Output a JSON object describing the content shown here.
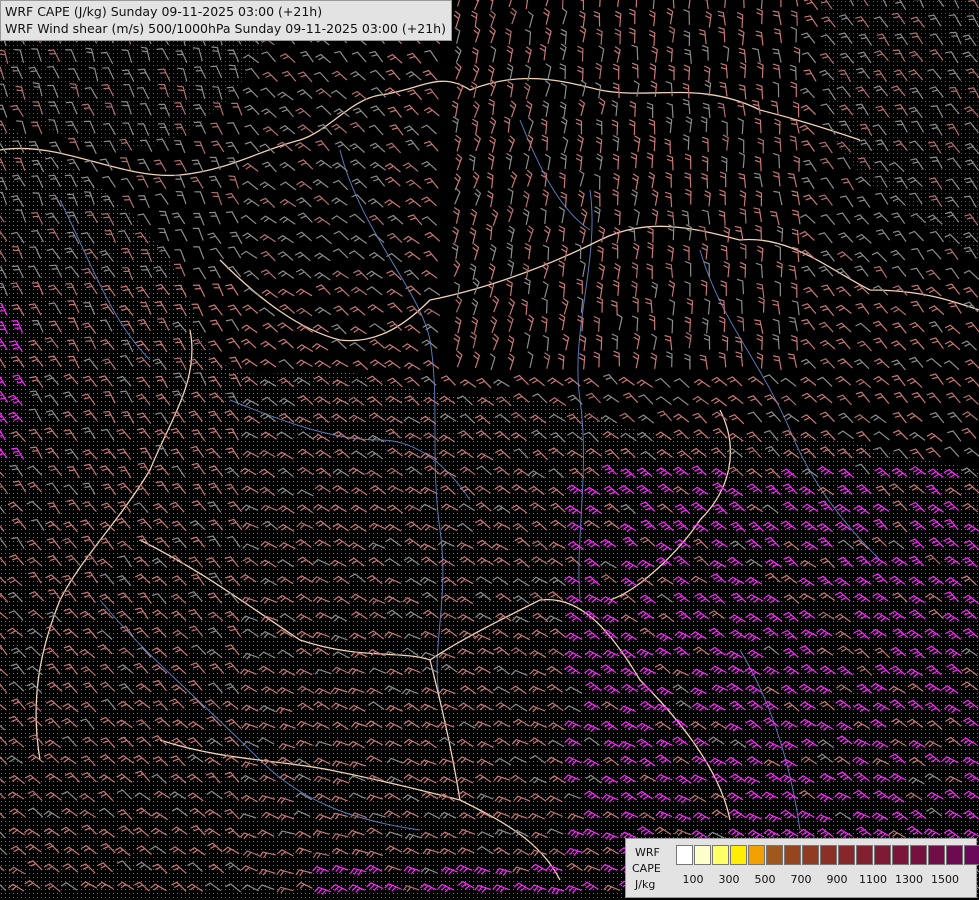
{
  "title": {
    "line1": "WRF CAPE (J/kg) Sunday 09-11-2025 03:00 (+21h)",
    "line2": "WRF Wind shear (m/s) 500/1000hPa Sunday 09-11-2025 03:00 (+21h)"
  },
  "legend": {
    "line1": "WRF",
    "line2": "CAPE",
    "line3": "J/kg",
    "colors": [
      "#ffffff",
      "#ffffcc",
      "#ffff66",
      "#ffee00",
      "#f2a100",
      "#a0581c",
      "#96461f",
      "#913b23",
      "#8c3027",
      "#87262b",
      "#83202f",
      "#7f1a34",
      "#7b1539",
      "#76113f",
      "#720e47",
      "#6e0b50",
      "#6a0959"
    ],
    "ticks": [
      "100",
      "300",
      "500",
      "700",
      "900",
      "1100",
      "1300",
      "1500"
    ]
  },
  "colors": {
    "background": "#000000",
    "borders": "#f0d2b4",
    "rivers": "#5a78b4",
    "barbs_low": "#8c8c8c",
    "barbs_mid": "#c87878",
    "barbs_high": "#ff28ff"
  }
}
